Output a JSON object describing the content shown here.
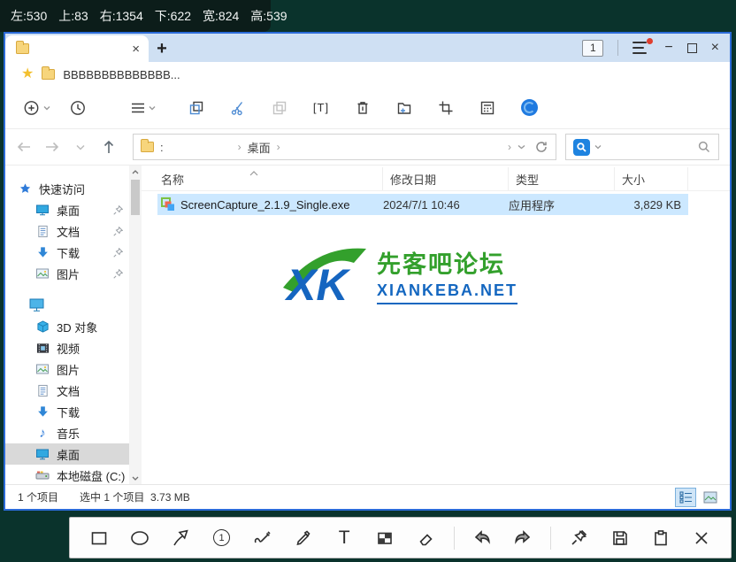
{
  "colors": {
    "outer_bg": "#0a332c",
    "window_border": "#2b6bd8",
    "tabstrip_bg": "#cfe0f3",
    "row_selection": "#cce8ff",
    "sidebar_selection": "#d9d9d9",
    "search_chip_blue": "#1e83e0",
    "watermark_green": "#33a02c",
    "watermark_blue": "#1467c0",
    "menu_badge_red": "#e03e2d"
  },
  "capture_info": {
    "segments": [
      "左:530",
      "上:83",
      "右:1354",
      "下:622",
      "宽:824",
      "高:539"
    ]
  },
  "glyphs": {
    "close": "×",
    "plus": "+",
    "minimize": "−",
    "star": "★",
    "music_note": "♪"
  },
  "titlebar": {
    "tab_count": "1"
  },
  "bookmark_bar": {
    "label": "BBBBBBBBBBBBBB..."
  },
  "toolbar": {
    "rename_label": "[T]"
  },
  "address_bar": {
    "drive_colon": ":",
    "crumb_sep": "›",
    "crumb": "桌面"
  },
  "file_list": {
    "columns": [
      "名称",
      "修改日期",
      "类型",
      "大小"
    ],
    "rows": [
      {
        "name": "ScreenCapture_2.1.9_Single.exe",
        "date": "2024/7/1 10:46",
        "type": "应用程序",
        "size": "3,829 KB"
      }
    ]
  },
  "sidebar": {
    "quick_access": "快速访问",
    "pinned": [
      "桌面",
      "文档",
      "下载",
      "图片"
    ],
    "this_pc_items": [
      "3D 对象",
      "视频",
      "图片",
      "文档",
      "下载",
      "音乐",
      "桌面",
      "本地磁盘 (C:)"
    ],
    "selected_item": "桌面"
  },
  "watermark": {
    "logo_text": "XK",
    "title": "先客吧论坛",
    "domain": "XIANKEBA.NET"
  },
  "status_bar": {
    "item_count": "1 个项目",
    "selection": "选中 1 个项目",
    "size": "3.73 MB"
  },
  "capture_toolbar": {
    "text_tool": "T",
    "number_tool": "1"
  }
}
